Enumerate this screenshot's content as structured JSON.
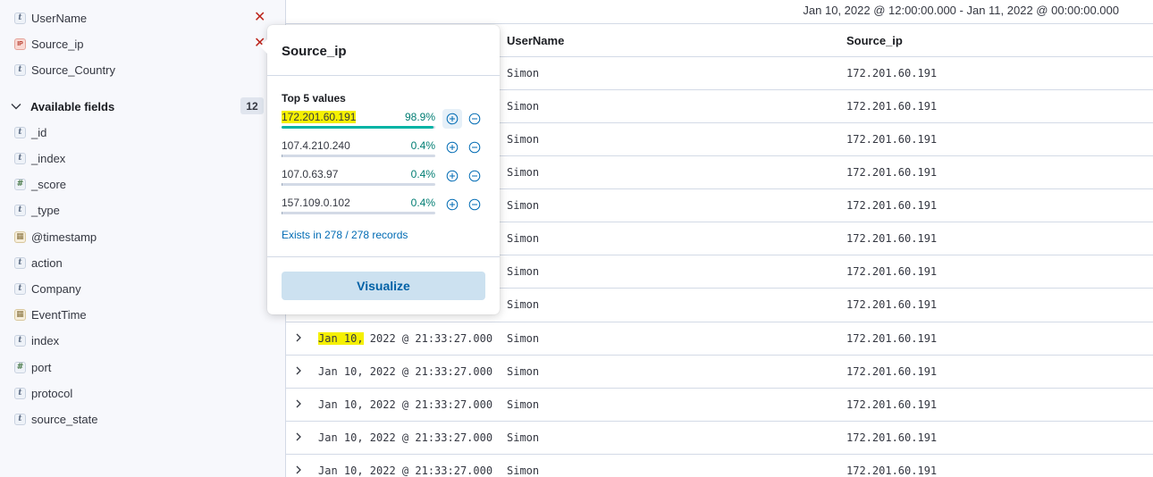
{
  "sidebar": {
    "selected_fields": [
      {
        "name": "UserName",
        "type_glyph": "t"
      },
      {
        "name": "Source_ip",
        "type_glyph": "IP"
      },
      {
        "name": "Source_Country",
        "type_glyph": "t"
      }
    ],
    "available_label": "Available fields",
    "available_count": "12",
    "available_fields": [
      {
        "name": "_id",
        "type_glyph": "t"
      },
      {
        "name": "_index",
        "type_glyph": "t"
      },
      {
        "name": "_score",
        "type_glyph": "#"
      },
      {
        "name": "_type",
        "type_glyph": "t"
      },
      {
        "name": "@timestamp",
        "type_glyph": "▦"
      },
      {
        "name": "action",
        "type_glyph": "t"
      },
      {
        "name": "Company",
        "type_glyph": "t"
      },
      {
        "name": "EventTime",
        "type_glyph": "▦"
      },
      {
        "name": "index",
        "type_glyph": "t"
      },
      {
        "name": "port",
        "type_glyph": "#"
      },
      {
        "name": "protocol",
        "type_glyph": "t"
      },
      {
        "name": "source_state",
        "type_glyph": "t"
      }
    ]
  },
  "header": {
    "date_range": "Jan 10, 2022 @ 12:00:00.000 - Jan 11, 2022 @ 00:00:00.000"
  },
  "table": {
    "columns": [
      "UserName",
      "Source_ip"
    ],
    "rows": [
      {
        "time": "",
        "user": "Simon",
        "ip": "172.201.60.191"
      },
      {
        "time": "",
        "user": "Simon",
        "ip": "172.201.60.191"
      },
      {
        "time": "",
        "user": "Simon",
        "ip": "172.201.60.191"
      },
      {
        "time": "",
        "user": "Simon",
        "ip": "172.201.60.191"
      },
      {
        "time": "",
        "user": "Simon",
        "ip": "172.201.60.191"
      },
      {
        "time": "",
        "user": "Simon",
        "ip": "172.201.60.191"
      },
      {
        "time": "",
        "user": "Simon",
        "ip": "172.201.60.191"
      },
      {
        "time": "",
        "user": "Simon",
        "ip": "172.201.60.191"
      },
      {
        "time_hl": "Jan 10,",
        "time_rest": " 2022 @ 21:33:27.000",
        "user": "Simon",
        "ip": "172.201.60.191"
      },
      {
        "time": "Jan 10, 2022 @ 21:33:27.000",
        "user": "Simon",
        "ip": "172.201.60.191"
      },
      {
        "time": "Jan 10, 2022 @ 21:33:27.000",
        "user": "Simon",
        "ip": "172.201.60.191"
      },
      {
        "time": "Jan 10, 2022 @ 21:33:27.000",
        "user": "Simon",
        "ip": "172.201.60.191"
      },
      {
        "time": "Jan 10, 2022 @ 21:33:27.000",
        "user": "Simon",
        "ip": "172.201.60.191"
      }
    ]
  },
  "popover": {
    "title": "Source_ip",
    "subtitle": "Top 5 values",
    "values": [
      {
        "label": "172.201.60.191",
        "pct_text": "98.9%",
        "pct": 98.9
      },
      {
        "label": "107.4.210.240",
        "pct_text": "0.4%",
        "pct": 0.4
      },
      {
        "label": "107.0.63.97",
        "pct_text": "0.4%",
        "pct": 0.4
      },
      {
        "label": "157.109.0.102",
        "pct_text": "0.4%",
        "pct": 0.4
      }
    ],
    "exists_text": "Exists in 278 / 278 records",
    "visualize_label": "Visualize"
  },
  "colors": {
    "accent": "#006bb4",
    "success": "#00b3a4",
    "danger": "#bd271e",
    "highlight": "#f5f000"
  }
}
